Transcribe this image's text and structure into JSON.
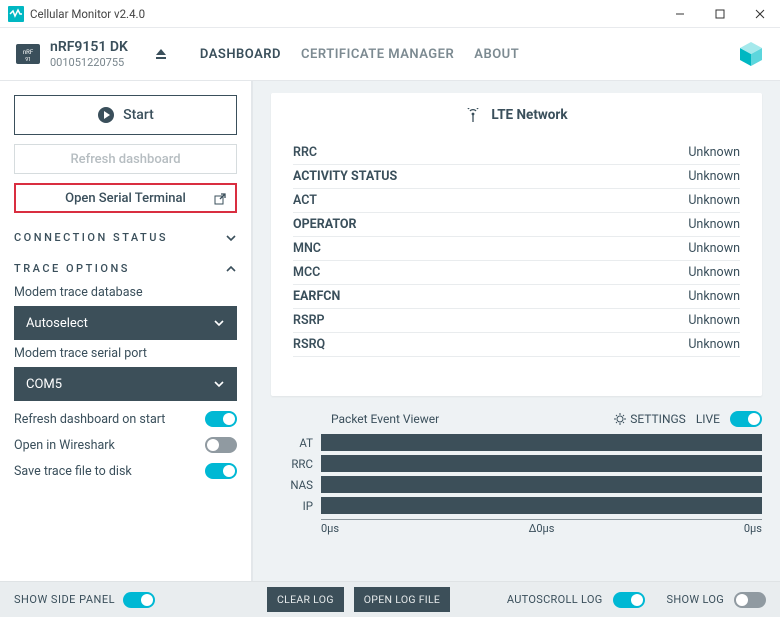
{
  "window": {
    "title": "Cellular Monitor v2.4.0"
  },
  "device": {
    "name": "nRF9151 DK",
    "serial": "001051220755"
  },
  "nav": {
    "dashboard": "DASHBOARD",
    "cert": "CERTIFICATE MANAGER",
    "about": "ABOUT"
  },
  "sidebar": {
    "start": "Start",
    "refresh_dash": "Refresh dashboard",
    "open_terminal": "Open Serial Terminal",
    "conn_status": "CONNECTION STATUS",
    "trace_options": "TRACE OPTIONS",
    "db_label": "Modem trace database",
    "db_value": "Autoselect",
    "port_label": "Modem trace serial port",
    "port_value": "COM5",
    "toggles": {
      "refresh_on_start": "Refresh dashboard on start",
      "wireshark": "Open in Wireshark",
      "save_trace": "Save trace file to disk"
    },
    "show_side": "SHOW SIDE PANEL"
  },
  "lte": {
    "title": "LTE Network",
    "rows": [
      {
        "k": "RRC",
        "v": "Unknown",
        "bold": false
      },
      {
        "k": "ACTIVITY STATUS",
        "v": "Unknown",
        "bold": true
      },
      {
        "k": "ACT",
        "v": "Unknown",
        "bold": false
      },
      {
        "k": "OPERATOR",
        "v": "Unknown",
        "bold": true
      },
      {
        "k": "MNC",
        "v": "Unknown",
        "bold": false
      },
      {
        "k": "MCC",
        "v": "Unknown",
        "bold": false
      },
      {
        "k": "EARFCN",
        "v": "Unknown",
        "bold": true
      },
      {
        "k": "RSRP",
        "v": "Unknown",
        "bold": false
      },
      {
        "k": "RSRQ",
        "v": "Unknown",
        "bold": false
      }
    ]
  },
  "viewer": {
    "title": "Packet Event Viewer",
    "settings": "SETTINGS",
    "live": "LIVE",
    "tracks": [
      "AT",
      "RRC",
      "NAS",
      "IP"
    ],
    "axis": {
      "left": "0µs",
      "mid": "Δ0µs",
      "right": "0µs"
    }
  },
  "footer": {
    "clear": "CLEAR LOG",
    "open_log": "OPEN LOG FILE",
    "autoscroll": "AUTOSCROLL LOG",
    "showlog": "SHOW LOG"
  }
}
